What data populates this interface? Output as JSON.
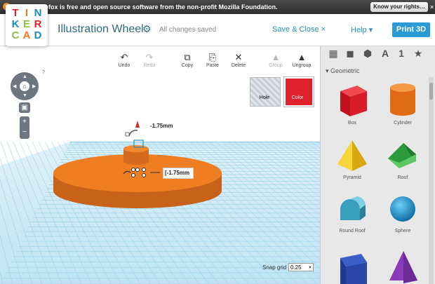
{
  "notification": {
    "message": "Mozilla Firefox is free and open source software from the non-profit Mozilla Foundation.",
    "button": "Know your rights…",
    "close": "×"
  },
  "header": {
    "logo_letters": [
      {
        "ch": "T",
        "color": "#e2232a"
      },
      {
        "ch": "I",
        "color": "#f47a20"
      },
      {
        "ch": "N",
        "color": "#1e8ac6"
      },
      {
        "ch": "K",
        "color": "#1e8ac6"
      },
      {
        "ch": "E",
        "color": "#8bbd3c"
      },
      {
        "ch": "R",
        "color": "#e2232a"
      },
      {
        "ch": "C",
        "color": "#8bbd3c"
      },
      {
        "ch": "A",
        "color": "#f47a20"
      },
      {
        "ch": "D",
        "color": "#1e8ac6"
      }
    ],
    "title": "Illustration Wheel",
    "gear_icon": "⚙",
    "status": "All changes saved",
    "save_close": "Save & Close ×",
    "help": "Help ▾",
    "print": "Print 3D"
  },
  "toolbar": {
    "undo": "Undo",
    "redo": "Redo",
    "copy": "Copy",
    "paste": "Paste",
    "delete": "Delete",
    "group": "Group",
    "ungroup": "Ungroup"
  },
  "inspector": {
    "hole": "Hole",
    "color": "Color",
    "color_value": "#e0202a"
  },
  "viewport": {
    "dim_height": "-1.75mm",
    "dim_input": "[-1.75mm",
    "snap_label": "Snap grid",
    "snap_value": "0.25",
    "help_q": "?",
    "home_icon": "⌂"
  },
  "sidebar": {
    "category": "Geometric",
    "tab_text_icon": "A",
    "tab_number_icon": "1",
    "tab_star_icon": "★",
    "shapes": [
      {
        "label": "Box",
        "color": "#d91c2c"
      },
      {
        "label": "Cylinder",
        "color": "#ef7d22"
      },
      {
        "label": "Pyramid",
        "color": "#f2c51c"
      },
      {
        "label": "Roof",
        "color": "#3bb24a"
      },
      {
        "label": "Round Roof",
        "color": "#4fb8d4"
      },
      {
        "label": "Sphere",
        "color": "#1c98d6"
      }
    ]
  }
}
